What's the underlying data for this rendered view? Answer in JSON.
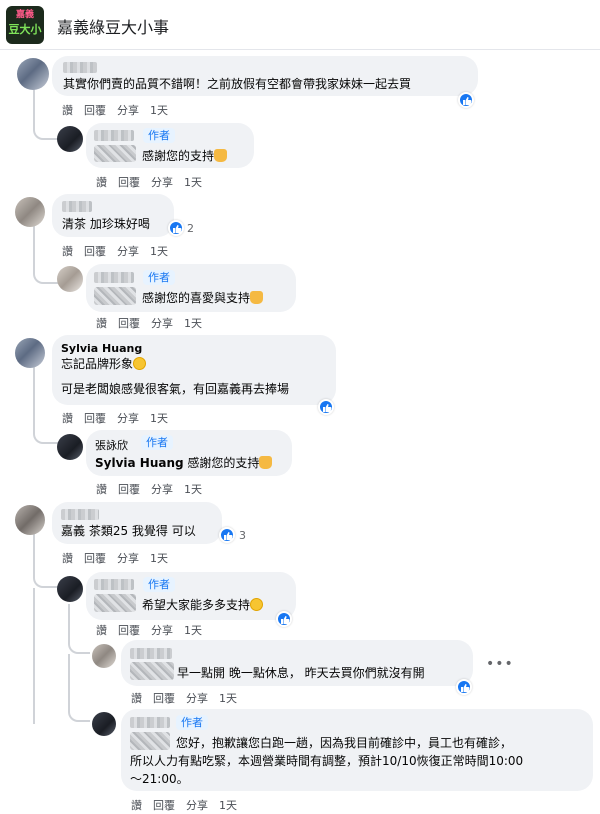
{
  "page": {
    "name": "嘉義綠豆大小事",
    "logo_line1": "嘉義",
    "logo_line2": "豆大小"
  },
  "actions": {
    "like": "讚",
    "reply": "回覆",
    "share": "分享",
    "time": "1天"
  },
  "author_tag": "作者",
  "comments": [
    {
      "text": "其實你們賣的品質不錯啊！之前放假有空都會帶我家妹妹一起去買"
    },
    {
      "text": "感謝您的支持"
    },
    {
      "text": "清茶 加珍珠好喝",
      "likes": "2"
    },
    {
      "text": "感謝您的喜愛與支持"
    },
    {
      "name": "Sylvia Huang",
      "line1": "忘記品牌形象",
      "line2": "可是老闆娘感覺很客氣，有回嘉義再去捧場"
    },
    {
      "name": "張詠欣",
      "mention": "Sylvia Huang",
      "text": " 感謝您的支持"
    },
    {
      "text": "嘉義 茶類25 我覺得 可以",
      "likes": "3"
    },
    {
      "text": "希望大家能多多支持"
    },
    {
      "text": "早一點開 晚一點休息， 昨天去買你們就沒有開"
    },
    {
      "line1": "您好，抱歉讓您白跑一趟，因為我目前確診中，員工也有確診，",
      "line2": "所以人力有點吃緊，本週營業時間有調整，預計10/10恢復正常時間10:00",
      "line3": "～21:00。"
    }
  ],
  "colors": {
    "accent": "#1877f2",
    "bubble": "#f0f2f5",
    "muted": "#65676b"
  },
  "icons": [
    "thumbs-up-icon",
    "praying-hands-icon",
    "laughing-emoji-icon",
    "smile-emoji-icon",
    "more-options-icon"
  ]
}
